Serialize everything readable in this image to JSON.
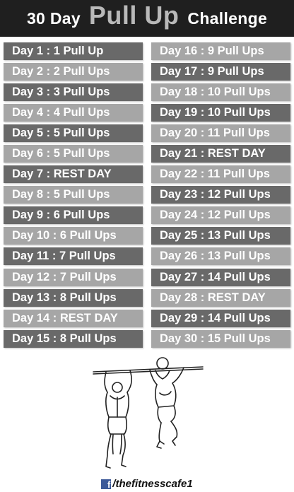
{
  "header": {
    "prefix": "30 Day",
    "highlight": "Pull Up",
    "suffix": "Challenge"
  },
  "days_left": [
    "Day 1 : 1 Pull Up",
    "Day 2 : 2 Pull Ups",
    "Day 3 : 3 Pull Ups",
    "Day 4 : 4 Pull Ups",
    "Day 5 : 5 Pull Ups",
    "Day 6 : 5 Pull Ups",
    "Day 7 : REST DAY",
    "Day 8 : 5 Pull Ups",
    "Day 9 : 6 Pull Ups",
    "Day 10 : 6 Pull Ups",
    "Day 11 : 7 Pull Ups",
    "Day 12 : 7 Pull Ups",
    "Day 13 : 8 Pull Ups",
    "Day 14 : REST DAY",
    "Day 15 : 8 Pull Ups"
  ],
  "days_right": [
    "Day 16 : 9 Pull Ups",
    "Day 17 : 9 Pull Ups",
    "Day 18 : 10 Pull Ups",
    "Day 19 : 10 Pull Ups",
    "Day 20 : 11 Pull Ups",
    "Day 21 : REST DAY",
    "Day 22 : 11 Pull Ups",
    "Day 23 : 12 Pull Ups",
    "Day 24 : 12 Pull Ups",
    "Day 25 : 13 Pull Ups",
    "Day 26 : 13 Pull Ups",
    "Day 27 : 14 Pull Ups",
    "Day 28 : REST DAY",
    "Day 29 : 14 Pull Ups",
    "Day 30 : 15 Pull Ups"
  ],
  "footer": {
    "icon": "facebook-icon",
    "handle": "/thefitnesscafe1"
  },
  "colors": {
    "header_bg": "#1f1f1f",
    "highlight": "#b9b9b9",
    "row_dark": "#696969",
    "row_light": "#a6a6a6",
    "facebook": "#3b5998"
  }
}
